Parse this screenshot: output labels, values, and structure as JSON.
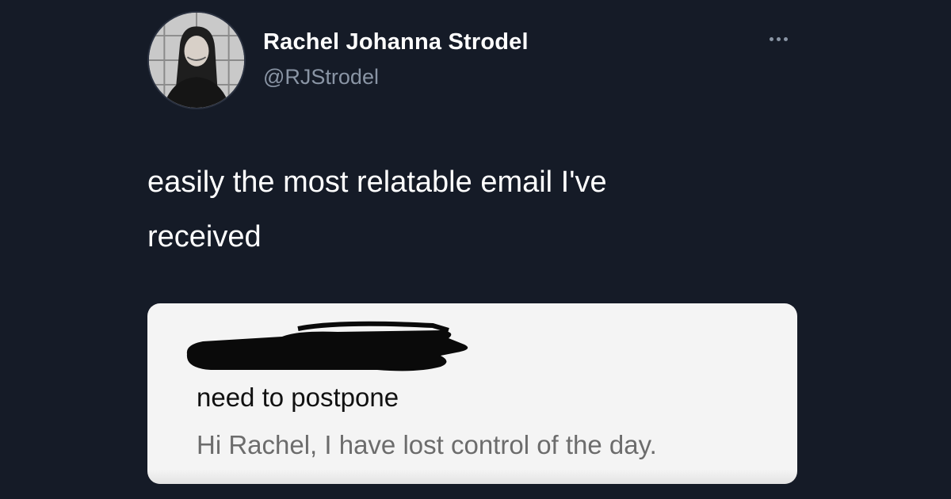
{
  "tweet": {
    "display_name": "Rachel Johanna Strodel",
    "handle": "@RJStrodel",
    "text_line1": "easily the most relatable email I've",
    "text_line2": "received",
    "more_icon": "more-horizontal-icon"
  },
  "email": {
    "subject": "need to postpone",
    "preview": "Hi Rachel, I have lost control of the day."
  },
  "colors": {
    "background": "#151b27",
    "name": "#ffffff",
    "handle": "#8a95a5",
    "card": "#f4f4f4",
    "subject": "#111111",
    "preview": "#6c6c6c"
  }
}
